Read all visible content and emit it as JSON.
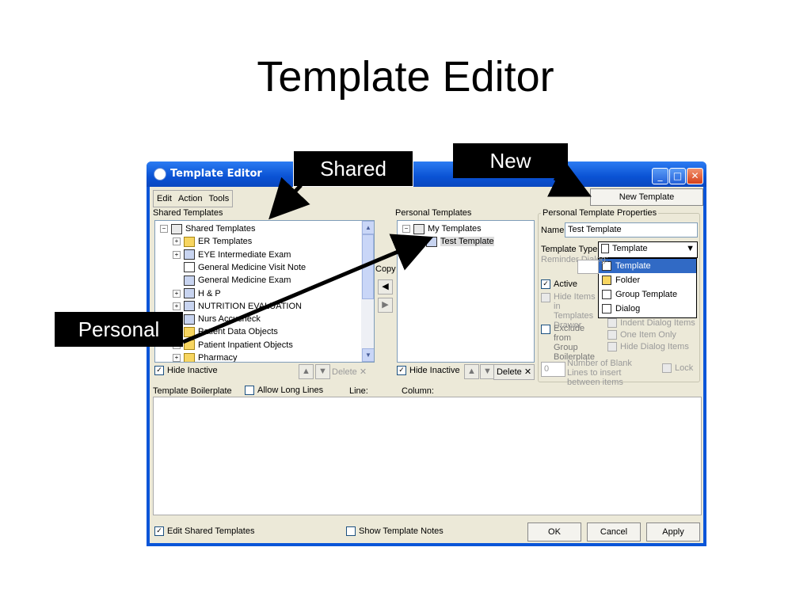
{
  "slide_title": "Template Editor",
  "window": {
    "title": "Template Editor",
    "menu": [
      "Edit",
      "Action",
      "Tools"
    ],
    "new_template_button": "New Template",
    "shared_templates_label": "Shared Templates",
    "shared_tree": [
      {
        "label": "Shared Templates",
        "icon": "book-icon",
        "exp": "−",
        "indent": 0
      },
      {
        "label": "ER Templates",
        "icon": "folder-icon",
        "exp": "+",
        "indent": 1
      },
      {
        "label": "EYE Intermediate Exam",
        "icon": "dialog-icon",
        "exp": "+",
        "indent": 1
      },
      {
        "label": "General Medicine Visit Note",
        "icon": "document-icon",
        "exp": "",
        "indent": 1
      },
      {
        "label": "General Medicine Exam",
        "icon": "dialog-icon",
        "exp": "",
        "indent": 1
      },
      {
        "label": "H & P",
        "icon": "dialog-icon",
        "exp": "+",
        "indent": 1
      },
      {
        "label": "NUTRITION EVALUATION",
        "icon": "dialog-icon",
        "exp": "+",
        "indent": 1
      },
      {
        "label": "Nurs Accucheck",
        "icon": "dialog-icon",
        "exp": "+",
        "indent": 1
      },
      {
        "label": "Patient Data Objects",
        "icon": "folder-icon",
        "exp": "+",
        "indent": 1
      },
      {
        "label": "Patient Inpatient Objects",
        "icon": "folder-icon",
        "exp": "+",
        "indent": 1
      },
      {
        "label": "Pharmacy",
        "icon": "folder-icon",
        "exp": "+",
        "indent": 1
      }
    ],
    "hide_inactive_label": "Hide Inactive",
    "delete_label": "Delete",
    "copy_label": "Copy",
    "personal_templates_label": "Personal Templates",
    "personal_tree": [
      {
        "label": "My Templates",
        "icon": "book-icon",
        "exp": "−",
        "indent": 0
      },
      {
        "label": "Test Template",
        "icon": "dialog-icon",
        "exp": "",
        "indent": 1
      }
    ],
    "properties": {
      "group_title": "Personal Template Properties",
      "name_label": "Name:",
      "name_value": "Test Template",
      "type_label": "Template Type:",
      "type_value": "Template",
      "type_options": [
        "Template",
        "Folder",
        "Group Template",
        "Dialog"
      ],
      "reminder_dialog_label": "Reminder Dialog:",
      "active_label": "Active",
      "hide_items_label": "Hide Items in Templates Drawer",
      "exclude_label": "Exclude from Group Boilerplate",
      "indent_dialog_label": "Indent Dialog Items",
      "one_item_label": "One Item Only",
      "hide_dialog_label": "Hide Dialog Items",
      "blank_lines_value": "0",
      "blank_lines_label": "Number of Blank Lines to insert between items",
      "lock_label": "Lock"
    },
    "boilerplate_label": "Template Boilerplate",
    "allow_long_lines_label": "Allow Long Lines",
    "line_label": "Line:",
    "column_label": "Column:",
    "edit_shared_label": "Edit Shared Templates",
    "show_notes_label": "Show Template Notes",
    "ok_label": "OK",
    "cancel_label": "Cancel",
    "apply_label": "Apply"
  },
  "callouts": {
    "shared": "Shared",
    "new": "New",
    "personal": "Personal"
  }
}
